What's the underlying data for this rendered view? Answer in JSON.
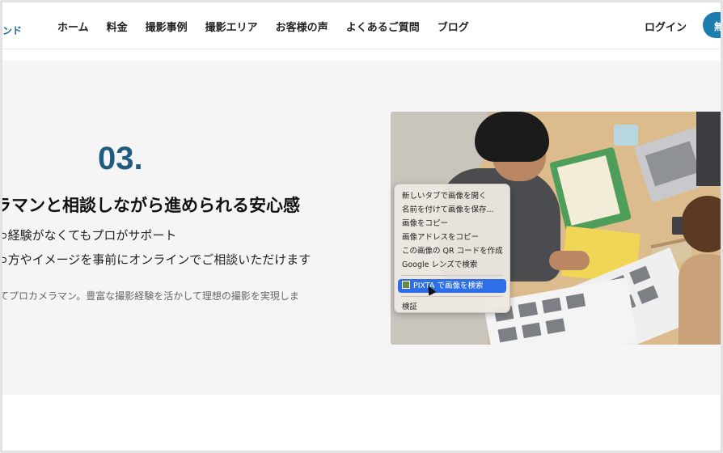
{
  "header": {
    "logo_fragment": "ンド",
    "nav": [
      "ホーム",
      "料金",
      "撮影事例",
      "撮影エリア",
      "お客様の声",
      "よくあるご質問",
      "ブログ"
    ],
    "login_label": "ログイン",
    "cta_label": "無"
  },
  "feature": {
    "number": "03.",
    "title": "ラマンと相談しながら進められる安心感",
    "bullets": [
      "経験がなくてもプロがサポート",
      "方やイメージを事前にオンラインでご相談いただけます"
    ],
    "description": "てプロカメラマン。豊富な撮影経験を活かして理想の撮影を実現しま"
  },
  "context_menu": {
    "items": [
      "新しいタブで画像を開く",
      "名前を付けて画像を保存...",
      "画像をコピー",
      "画像アドレスをコピー",
      "この画像の QR コードを作成",
      "Google レンズで検索"
    ],
    "active_item": "PIXTA で画像を検索",
    "inspect_item": "検証"
  },
  "colors": {
    "accent": "#1d7db0",
    "number": "#1f5c7f",
    "menu_highlight": "#2e6ee6"
  }
}
